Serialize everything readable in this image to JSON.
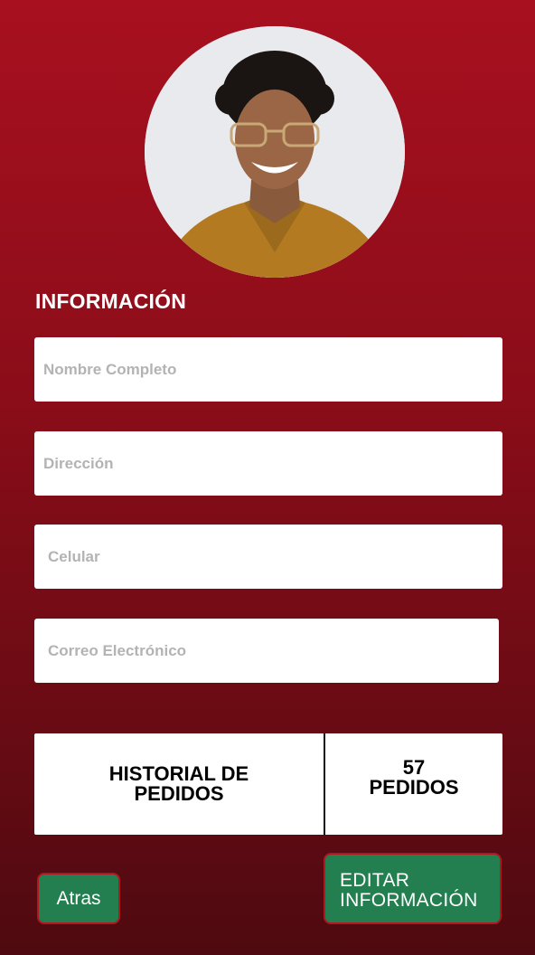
{
  "profile": {
    "photo": "profile-photo"
  },
  "section_title": "INFORMACIÓN",
  "fields": {
    "full_name": {
      "placeholder": "Nombre Completo",
      "value": ""
    },
    "address": {
      "placeholder": "Dirección",
      "value": ""
    },
    "phone": {
      "placeholder": "Celular",
      "value": ""
    },
    "email": {
      "placeholder": "Correo Electrónico",
      "value": ""
    }
  },
  "orders": {
    "history_label": "HISTORIAL DE PEDIDOS",
    "count": "57",
    "count_label": "PEDIDOS"
  },
  "buttons": {
    "back": "Atras",
    "edit_line1": "EDITAR",
    "edit_line2": "INFORMACIÓN"
  },
  "colors": {
    "background_top": "#a8101f",
    "background_bottom": "#4e0a10",
    "button_green": "#237f4f",
    "button_border": "#b0171f"
  }
}
